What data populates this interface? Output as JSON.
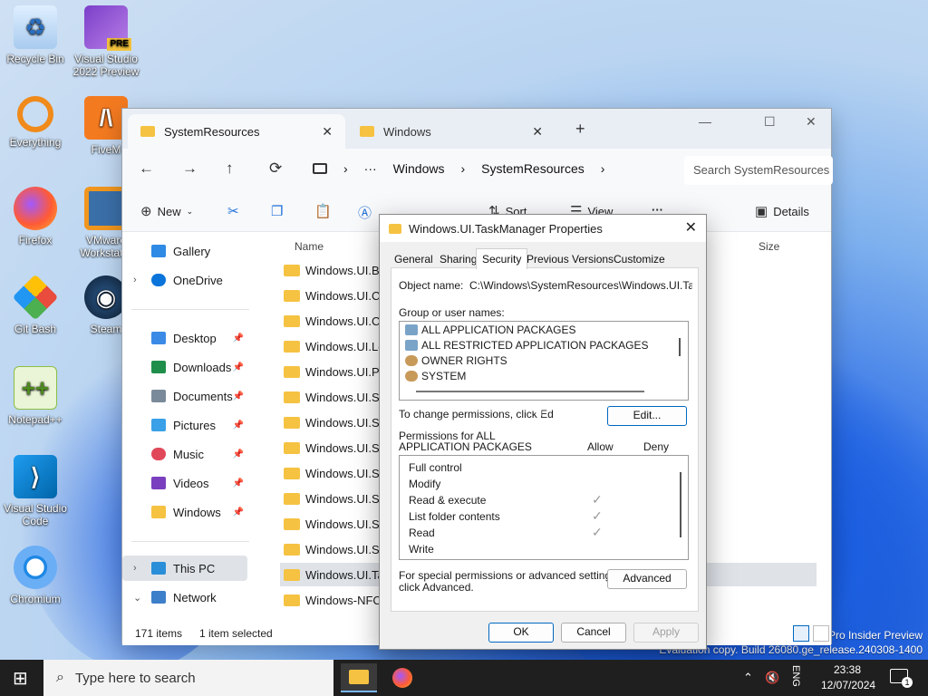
{
  "desktop": {
    "icons": [
      {
        "label": "Recycle Bin"
      },
      {
        "label": "Visual Studio 2022 Preview",
        "badge": "PRE"
      },
      {
        "label": "Everything"
      },
      {
        "label": "FiveM"
      },
      {
        "label": "Firefox"
      },
      {
        "label": "VMware Workstat..."
      },
      {
        "label": "Git Bash"
      },
      {
        "label": "Steam"
      },
      {
        "label": "Notepad++"
      },
      {
        "label": "Visual Studio Code"
      },
      {
        "label": "Chromium"
      }
    ],
    "watermark_line1": "Pro Insider Preview",
    "watermark_line2": "Evaluation copy. Build 26080.ge_release.240308-1400"
  },
  "explorer": {
    "tabs": [
      {
        "label": "SystemResources",
        "close": "✕"
      },
      {
        "label": "Windows",
        "close": "✕"
      }
    ],
    "new_tab": "+",
    "window_controls": {
      "minimize": "—",
      "maximize": "☐",
      "close": "✕"
    },
    "nav": {
      "back": "←",
      "forward": "→",
      "up": "↑",
      "refresh": "⟳",
      "more": "···"
    },
    "breadcrumbs": [
      "Windows",
      "SystemResources"
    ],
    "crumb_sep": "›",
    "search_placeholder": "Search SystemResources",
    "commands": {
      "new": "New",
      "sort": "Sort",
      "view": "View",
      "more": "···",
      "details": "Details"
    },
    "nav_pane": [
      {
        "label": "Gallery"
      },
      {
        "label": "OneDrive"
      },
      {
        "label": "Desktop"
      },
      {
        "label": "Downloads"
      },
      {
        "label": "Documents"
      },
      {
        "label": "Pictures"
      },
      {
        "label": "Music"
      },
      {
        "label": "Videos"
      },
      {
        "label": "Windows"
      },
      {
        "label": "This PC"
      },
      {
        "label": "Network"
      }
    ],
    "columns": {
      "name": "Name",
      "size": "Size"
    },
    "files": [
      "Windows.UI.Bloc",
      "Windows.UI.Cor",
      "Windows.UI.Cred",
      "Windows.UI.Log",
      "Windows.UI.PCS",
      "Windows.UI.Sear",
      "Windows.UI.Sett",
      "Windows.UI.Sett",
      "Windows.UI.Sett",
      "Windows.UI.Shel",
      "Windows.UI.Shel",
      "Windows.UI.Shel",
      "Windows.UI.Task",
      "Windows-NFC-S"
    ],
    "selected_file_index": 12,
    "status": {
      "items": "171 items",
      "selected": "1 item selected"
    }
  },
  "dialog": {
    "title": "Windows.UI.TaskManager Properties",
    "close": "✕",
    "tabs": [
      "General",
      "Sharing",
      "Security",
      "Previous Versions",
      "Customize"
    ],
    "active_tab": "Security",
    "object_name_label": "Object name:",
    "object_name_value": "C:\\Windows\\SystemResources\\Windows.UI.Task",
    "group_label": "Group or user names:",
    "groups": [
      "ALL APPLICATION PACKAGES",
      "ALL RESTRICTED APPLICATION PACKAGES",
      "OWNER RIGHTS",
      "SYSTEM"
    ],
    "change_text": "To change permissions, click Ed",
    "edit_button": "Edit...",
    "perm_label_line1": "Permissions for ALL",
    "perm_label_line2": "APPLICATION PACKAGES",
    "allow_header": "Allow",
    "deny_header": "Deny",
    "permissions": [
      {
        "name": "Full control",
        "allow": false
      },
      {
        "name": "Modify",
        "allow": false
      },
      {
        "name": "Read & execute",
        "allow": true
      },
      {
        "name": "List folder contents",
        "allow": true
      },
      {
        "name": "Read",
        "allow": true
      },
      {
        "name": "Write",
        "allow": false
      }
    ],
    "check_glyph": "✓",
    "special_line1": "For special permissions or advanced settings,",
    "special_line2": "click Advanced.",
    "advanced_button": "Advanced",
    "ok": "OK",
    "cancel": "Cancel",
    "apply": "Apply"
  },
  "taskbar": {
    "start_glyph": "⊞",
    "search_placeholder": "Type here to search",
    "lang": "ENG",
    "time": "23:38",
    "date": "12/07/2024",
    "notification_count": "1"
  }
}
